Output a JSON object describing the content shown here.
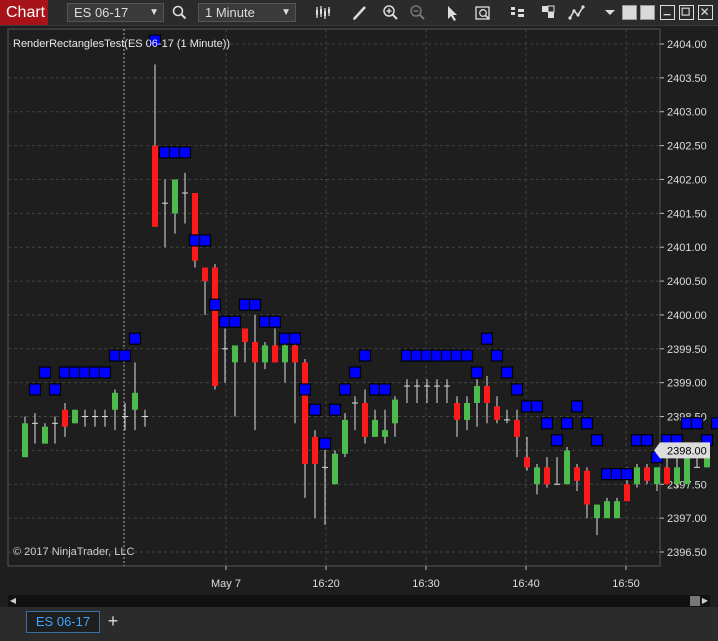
{
  "window": {
    "title": "Chart",
    "instrument": "ES 06-17",
    "interval": "1 Minute"
  },
  "toolbar_icons": [
    "bar-type-icon",
    "pencil-icon",
    "zoom-in-icon",
    "zoom-out-icon",
    "pointer-icon",
    "data-box-icon",
    "strategies-icon",
    "templates-icon",
    "properties-icon"
  ],
  "indicator_label": "RenderRectanglesTest(ES 06-17 (1 Minute))",
  "copyright": "© 2017 NinjaTrader, LLC",
  "price_axis": {
    "labels": [
      "2404.00",
      "2403.50",
      "2403.00",
      "2402.50",
      "2402.00",
      "2401.50",
      "2401.00",
      "2400.50",
      "2400.00",
      "2399.50",
      "2399.00",
      "2398.50",
      "2398.00",
      "2397.50",
      "2397.00",
      "2396.50"
    ],
    "current": "2398.00"
  },
  "time_axis": {
    "labels": [
      "May 7",
      "16:20",
      "16:30",
      "16:40",
      "16:50"
    ]
  },
  "colors": {
    "up": "#4cbb4c",
    "down": "#ff1a1a",
    "marker": "#0000ff",
    "current_price_bg": "#dddddd"
  },
  "chart_data": {
    "type": "candlestick",
    "ylim": [
      2396.5,
      2404.0
    ],
    "candles": [
      {
        "o": 2397.9,
        "h": 2398.5,
        "l": 2397.9,
        "c": 2398.4
      },
      {
        "o": 2398.4,
        "h": 2398.55,
        "l": 2398.1,
        "c": 2398.4
      },
      {
        "o": 2398.1,
        "h": 2398.4,
        "l": 2398.1,
        "c": 2398.35
      },
      {
        "o": 2398.4,
        "h": 2398.5,
        "l": 2398.1,
        "c": 2398.4
      },
      {
        "o": 2398.6,
        "h": 2398.7,
        "l": 2398.2,
        "c": 2398.35
      },
      {
        "o": 2398.4,
        "h": 2398.6,
        "l": 2398.4,
        "c": 2398.6
      },
      {
        "o": 2398.5,
        "h": 2398.6,
        "l": 2398.35,
        "c": 2398.5
      },
      {
        "o": 2398.5,
        "h": 2398.6,
        "l": 2398.35,
        "c": 2398.5
      },
      {
        "o": 2398.5,
        "h": 2398.6,
        "l": 2398.35,
        "c": 2398.5
      },
      {
        "o": 2398.6,
        "h": 2398.9,
        "l": 2398.3,
        "c": 2398.85
      },
      {
        "o": 2398.5,
        "h": 2398.7,
        "l": 2398.3,
        "c": 2398.5
      },
      {
        "o": 2398.6,
        "h": 2399.3,
        "l": 2398.3,
        "c": 2398.85
      },
      {
        "o": 2398.5,
        "h": 2398.6,
        "l": 2398.35,
        "c": 2398.5
      },
      {
        "o": 2402.5,
        "h": 2403.7,
        "l": 2401.5,
        "c": 2401.3
      },
      {
        "o": 2401.65,
        "h": 2402.0,
        "l": 2401.0,
        "c": 2401.65
      },
      {
        "o": 2401.5,
        "h": 2402.0,
        "l": 2401.2,
        "c": 2402.0
      },
      {
        "o": 2401.8,
        "h": 2402.1,
        "l": 2401.35,
        "c": 2401.8
      },
      {
        "o": 2401.8,
        "h": 2401.8,
        "l": 2400.7,
        "c": 2400.8
      },
      {
        "o": 2400.7,
        "h": 2400.7,
        "l": 2400.0,
        "c": 2400.5
      },
      {
        "o": 2400.7,
        "h": 2400.75,
        "l": 2398.9,
        "c": 2398.95
      },
      {
        "o": 2399.5,
        "h": 2399.8,
        "l": 2399.0,
        "c": 2399.5
      },
      {
        "o": 2399.3,
        "h": 2399.5,
        "l": 2398.5,
        "c": 2399.55
      },
      {
        "o": 2399.8,
        "h": 2399.8,
        "l": 2399.3,
        "c": 2399.6
      },
      {
        "o": 2399.6,
        "h": 2400.0,
        "l": 2398.3,
        "c": 2399.3
      },
      {
        "o": 2399.3,
        "h": 2399.6,
        "l": 2399.2,
        "c": 2399.55
      },
      {
        "o": 2399.55,
        "h": 2399.8,
        "l": 2399.3,
        "c": 2399.3
      },
      {
        "o": 2399.3,
        "h": 2399.6,
        "l": 2399.0,
        "c": 2399.55
      },
      {
        "o": 2399.55,
        "h": 2399.6,
        "l": 2398.4,
        "c": 2399.3
      },
      {
        "o": 2399.3,
        "h": 2399.35,
        "l": 2397.3,
        "c": 2397.8
      },
      {
        "o": 2398.2,
        "h": 2398.3,
        "l": 2397.0,
        "c": 2397.8
      },
      {
        "o": 2397.75,
        "h": 2398.1,
        "l": 2396.9,
        "c": 2397.75
      },
      {
        "o": 2397.5,
        "h": 2398.0,
        "l": 2397.5,
        "c": 2397.95
      },
      {
        "o": 2397.95,
        "h": 2398.55,
        "l": 2397.9,
        "c": 2398.45
      },
      {
        "o": 2398.7,
        "h": 2398.8,
        "l": 2398.3,
        "c": 2398.7
      },
      {
        "o": 2398.7,
        "h": 2398.9,
        "l": 2398.1,
        "c": 2398.2
      },
      {
        "o": 2398.2,
        "h": 2398.6,
        "l": 2398.2,
        "c": 2398.45
      },
      {
        "o": 2398.2,
        "h": 2398.6,
        "l": 2398.1,
        "c": 2398.3
      },
      {
        "o": 2398.4,
        "h": 2398.8,
        "l": 2398.2,
        "c": 2398.75
      }
    ],
    "candles2": [
      {
        "o": 2398.95,
        "h": 2399.05,
        "l": 2398.7,
        "c": 2398.95
      },
      {
        "o": 2398.95,
        "h": 2399.05,
        "l": 2398.7,
        "c": 2398.95
      },
      {
        "o": 2398.95,
        "h": 2399.05,
        "l": 2398.7,
        "c": 2398.95
      },
      {
        "o": 2398.95,
        "h": 2399.05,
        "l": 2398.7,
        "c": 2398.95
      },
      {
        "o": 2398.95,
        "h": 2399.05,
        "l": 2398.7,
        "c": 2398.95
      },
      {
        "o": 2398.7,
        "h": 2398.8,
        "l": 2398.2,
        "c": 2398.45
      },
      {
        "o": 2398.45,
        "h": 2398.8,
        "l": 2398.3,
        "c": 2398.7
      },
      {
        "o": 2398.7,
        "h": 2399.05,
        "l": 2398.35,
        "c": 2398.95
      },
      {
        "o": 2398.95,
        "h": 2399.1,
        "l": 2398.4,
        "c": 2398.7
      },
      {
        "o": 2398.65,
        "h": 2398.8,
        "l": 2398.4,
        "c": 2398.45
      },
      {
        "o": 2398.45,
        "h": 2398.6,
        "l": 2398.4,
        "c": 2398.45
      },
      {
        "o": 2398.45,
        "h": 2398.6,
        "l": 2397.9,
        "c": 2398.2
      },
      {
        "o": 2397.9,
        "h": 2398.2,
        "l": 2397.7,
        "c": 2397.75
      },
      {
        "o": 2397.5,
        "h": 2397.8,
        "l": 2397.35,
        "c": 2397.75
      },
      {
        "o": 2397.75,
        "h": 2397.9,
        "l": 2397.45,
        "c": 2397.5
      },
      {
        "o": 2397.5,
        "h": 2397.9,
        "l": 2397.5,
        "c": 2397.5
      },
      {
        "o": 2397.5,
        "h": 2398.05,
        "l": 2397.5,
        "c": 2398.0
      },
      {
        "o": 2397.75,
        "h": 2397.8,
        "l": 2397.4,
        "c": 2397.55
      },
      {
        "o": 2397.7,
        "h": 2397.75,
        "l": 2397.0,
        "c": 2397.2
      },
      {
        "o": 2397.0,
        "h": 2397.2,
        "l": 2396.75,
        "c": 2397.2
      },
      {
        "o": 2397.0,
        "h": 2397.3,
        "l": 2397.0,
        "c": 2397.25
      },
      {
        "o": 2397.0,
        "h": 2397.3,
        "l": 2397.0,
        "c": 2397.25
      },
      {
        "o": 2397.5,
        "h": 2397.75,
        "l": 2397.3,
        "c": 2397.25
      },
      {
        "o": 2397.5,
        "h": 2397.8,
        "l": 2397.45,
        "c": 2397.75
      },
      {
        "o": 2397.75,
        "h": 2397.8,
        "l": 2397.5,
        "c": 2397.55
      },
      {
        "o": 2397.5,
        "h": 2397.75,
        "l": 2397.4,
        "c": 2397.75
      },
      {
        "o": 2397.75,
        "h": 2397.95,
        "l": 2397.5,
        "c": 2397.5
      },
      {
        "o": 2397.5,
        "h": 2397.95,
        "l": 2397.45,
        "c": 2397.75
      },
      {
        "o": 2397.5,
        "h": 2398.0,
        "l": 2397.5,
        "c": 2397.95
      },
      {
        "o": 2397.75,
        "h": 2398.0,
        "l": 2397.75,
        "c": 2397.75
      },
      {
        "o": 2397.75,
        "h": 2398.05,
        "l": 2397.75,
        "c": 2398.0
      }
    ],
    "markers": [
      [
        1,
        2398.9
      ],
      [
        2,
        2399.15
      ],
      [
        3,
        2398.9
      ],
      [
        4,
        2399.15
      ],
      [
        5,
        2399.15
      ],
      [
        6,
        2399.15
      ],
      [
        7,
        2399.15
      ],
      [
        8,
        2399.15
      ],
      [
        9,
        2399.4
      ],
      [
        10,
        2399.4
      ],
      [
        11,
        2399.65
      ],
      [
        13,
        2404.05
      ],
      [
        14,
        2402.4
      ],
      [
        15,
        2402.4
      ],
      [
        16,
        2402.4
      ],
      [
        17,
        2401.1
      ],
      [
        18,
        2401.1
      ],
      [
        19,
        2400.15
      ],
      [
        20,
        2399.9
      ],
      [
        21,
        2399.9
      ],
      [
        22,
        2400.15
      ],
      [
        23,
        2400.15
      ],
      [
        24,
        2399.9
      ],
      [
        25,
        2399.9
      ],
      [
        26,
        2399.65
      ],
      [
        27,
        2399.65
      ],
      [
        28,
        2398.9
      ],
      [
        29,
        2398.6
      ],
      [
        30,
        2398.1
      ],
      [
        31,
        2398.6
      ],
      [
        32,
        2398.9
      ],
      [
        33,
        2399.15
      ],
      [
        34,
        2399.4
      ],
      [
        35,
        2398.9
      ],
      [
        36,
        2398.9
      ]
    ],
    "markers2": [
      [
        0,
        2399.4
      ],
      [
        1,
        2399.4
      ],
      [
        2,
        2399.4
      ],
      [
        3,
        2399.4
      ],
      [
        4,
        2399.4
      ],
      [
        5,
        2399.4
      ],
      [
        6,
        2399.4
      ],
      [
        7,
        2399.15
      ],
      [
        8,
        2399.65
      ],
      [
        9,
        2399.4
      ],
      [
        10,
        2399.15
      ],
      [
        11,
        2398.9
      ],
      [
        12,
        2398.65
      ],
      [
        13,
        2398.65
      ],
      [
        14,
        2398.4
      ],
      [
        15,
        2398.15
      ],
      [
        16,
        2398.4
      ],
      [
        17,
        2398.65
      ],
      [
        18,
        2398.4
      ],
      [
        19,
        2398.15
      ],
      [
        20,
        2397.65
      ],
      [
        21,
        2397.65
      ],
      [
        22,
        2397.65
      ],
      [
        23,
        2398.15
      ],
      [
        24,
        2398.15
      ],
      [
        25,
        2397.9
      ],
      [
        26,
        2398.15
      ],
      [
        27,
        2398.15
      ],
      [
        28,
        2398.4
      ],
      [
        29,
        2398.4
      ],
      [
        30,
        2398.15
      ],
      [
        31,
        2398.4
      ],
      [
        32,
        2398.4
      ]
    ]
  }
}
